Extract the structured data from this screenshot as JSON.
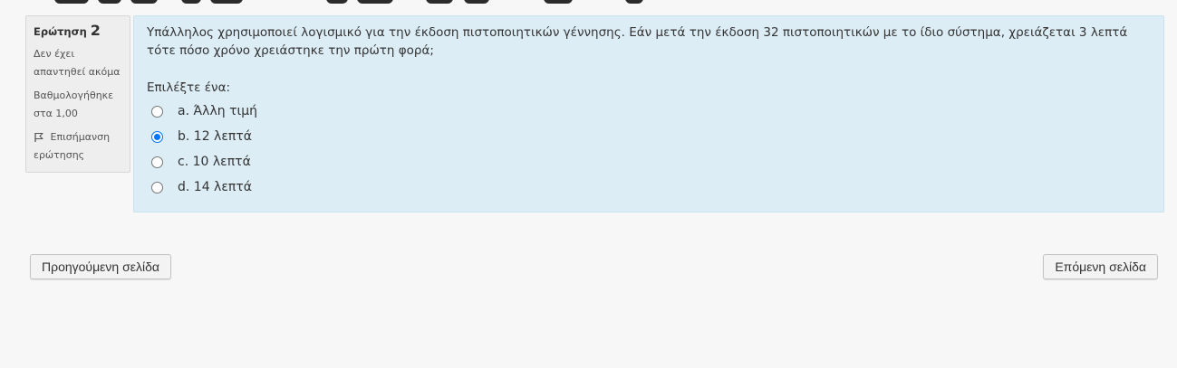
{
  "question_info": {
    "label": "Ερώτηση",
    "number": "2",
    "status": "Δεν έχει απαντηθεί ακόμα",
    "grade": "Βαθμολογήθηκε στα 1,00",
    "flag_label": "Επισήμανση ερώτησης"
  },
  "question": {
    "text": "Υπάλληλος χρησιμοποιεί λογισμικό για την έκδοση πιστοποιητικών γέννησης. Εάν μετά την έκδοση 32 πιστοποιητικών με το ίδιο σύστημα, χρειάζεται 3 λεπτά τότε πόσο χρόνο χρειάστηκε την πρώτη φορά;",
    "prompt": "Επιλέξτε ένα:",
    "answers": [
      {
        "label": "a. Άλλη τιμή",
        "selected": false
      },
      {
        "label": "b. 12 λεπτά",
        "selected": true
      },
      {
        "label": "c. 10 λεπτά",
        "selected": false
      },
      {
        "label": "d. 14 λεπτά",
        "selected": false
      }
    ]
  },
  "navigation": {
    "prev_label": "Προηγούμενη σελίδα",
    "next_label": "Επόμενη σελίδα"
  },
  "colors": {
    "content_bg": "#dcedf6",
    "radio_selected": "#0075ff"
  }
}
